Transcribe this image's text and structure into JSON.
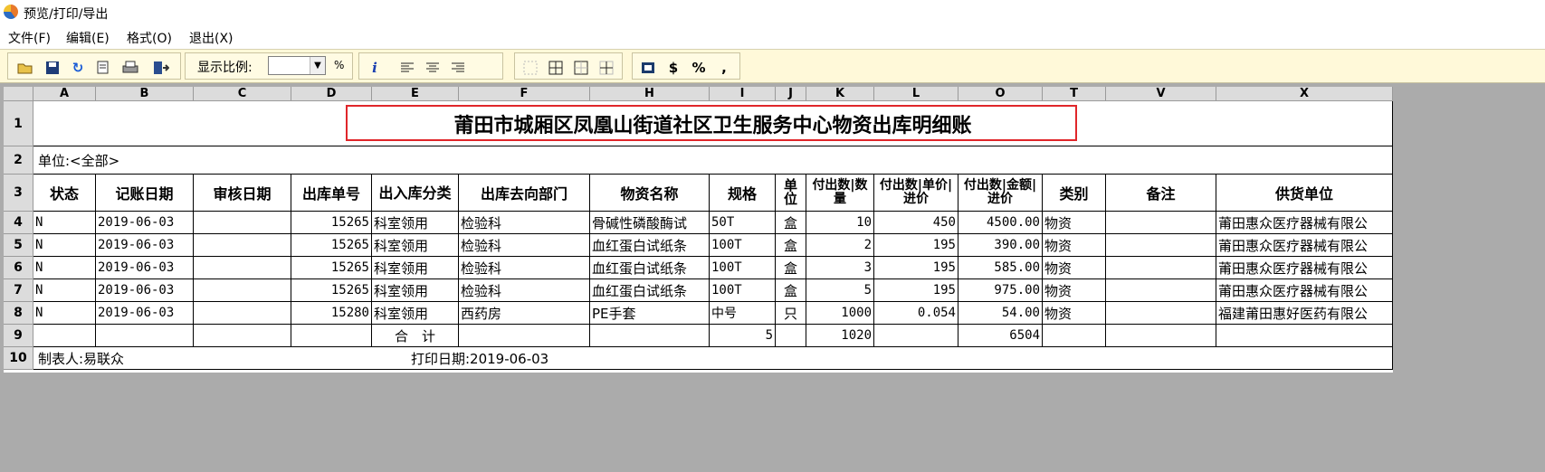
{
  "window": {
    "title": "预览/打印/导出"
  },
  "menu": [
    "文件(F)",
    "编辑(E)",
    "格式(O)",
    "退出(X)"
  ],
  "toolbar": {
    "zoom_label": "显示比例:",
    "zoom_value": "",
    "percent": "%",
    "icons": [
      "open-icon",
      "save-icon",
      "refresh-icon",
      "print-preview-icon",
      "print-icon",
      "exit-icon",
      "info-icon",
      "align-left-icon",
      "align-center-icon",
      "align-right-icon",
      "no-border-icon",
      "all-borders-icon",
      "outer-border-icon",
      "inner-border-icon",
      "number-format-icon",
      "currency-icon",
      "percent-icon",
      "comma-icon"
    ]
  },
  "sheet": {
    "columns": [
      "A",
      "B",
      "C",
      "D",
      "E",
      "F",
      "H",
      "I",
      "J",
      "K",
      "L",
      "O",
      "T",
      "V",
      "X"
    ],
    "rows": [
      "1",
      "2",
      "3",
      "4",
      "5",
      "6",
      "7",
      "8",
      "9",
      "10"
    ],
    "title": "莆田市城厢区凤凰山街道社区卫生服务中心物资出库明细账",
    "unit": "单位:<全部>",
    "headers": [
      "状态",
      "记账日期",
      "审核日期",
      "出库单号",
      "出入库分类",
      "出库去向部门",
      "物资名称",
      "规格",
      "单位",
      "付出数|数量",
      "付出数|单价|进价",
      "付出数|金额|进价",
      "类别",
      "备注",
      "供货单位"
    ],
    "data_rows": [
      [
        "N",
        "2019-06-03",
        "",
        "15265",
        "科室领用",
        "检验科",
        "骨碱性磷酸酶试",
        "50T",
        "盒",
        "10",
        "450",
        "4500.00",
        "物资",
        "",
        "莆田惠众医疗器械有限公"
      ],
      [
        "N",
        "2019-06-03",
        "",
        "15265",
        "科室领用",
        "检验科",
        "血红蛋白试纸条",
        "100T",
        "盒",
        "2",
        "195",
        "390.00",
        "物资",
        "",
        "莆田惠众医疗器械有限公"
      ],
      [
        "N",
        "2019-06-03",
        "",
        "15265",
        "科室领用",
        "检验科",
        "血红蛋白试纸条",
        "100T",
        "盒",
        "3",
        "195",
        "585.00",
        "物资",
        "",
        "莆田惠众医疗器械有限公"
      ],
      [
        "N",
        "2019-06-03",
        "",
        "15265",
        "科室领用",
        "检验科",
        "血红蛋白试纸条",
        "100T",
        "盒",
        "5",
        "195",
        "975.00",
        "物资",
        "",
        "莆田惠众医疗器械有限公"
      ],
      [
        "N",
        "2019-06-03",
        "",
        "15280",
        "科室领用",
        "西药房",
        "PE手套",
        "中号",
        "只",
        "1000",
        "0.054",
        "54.00",
        "物资",
        "",
        "福建莆田惠好医药有限公"
      ]
    ],
    "total_row": {
      "label": "合　计",
      "count": "5",
      "qty": "1020",
      "amount": "6504"
    },
    "footer": {
      "maker": "制表人:易联众",
      "print_date": "打印日期:2019-06-03"
    },
    "title_highlight_color": "#e0262a"
  }
}
